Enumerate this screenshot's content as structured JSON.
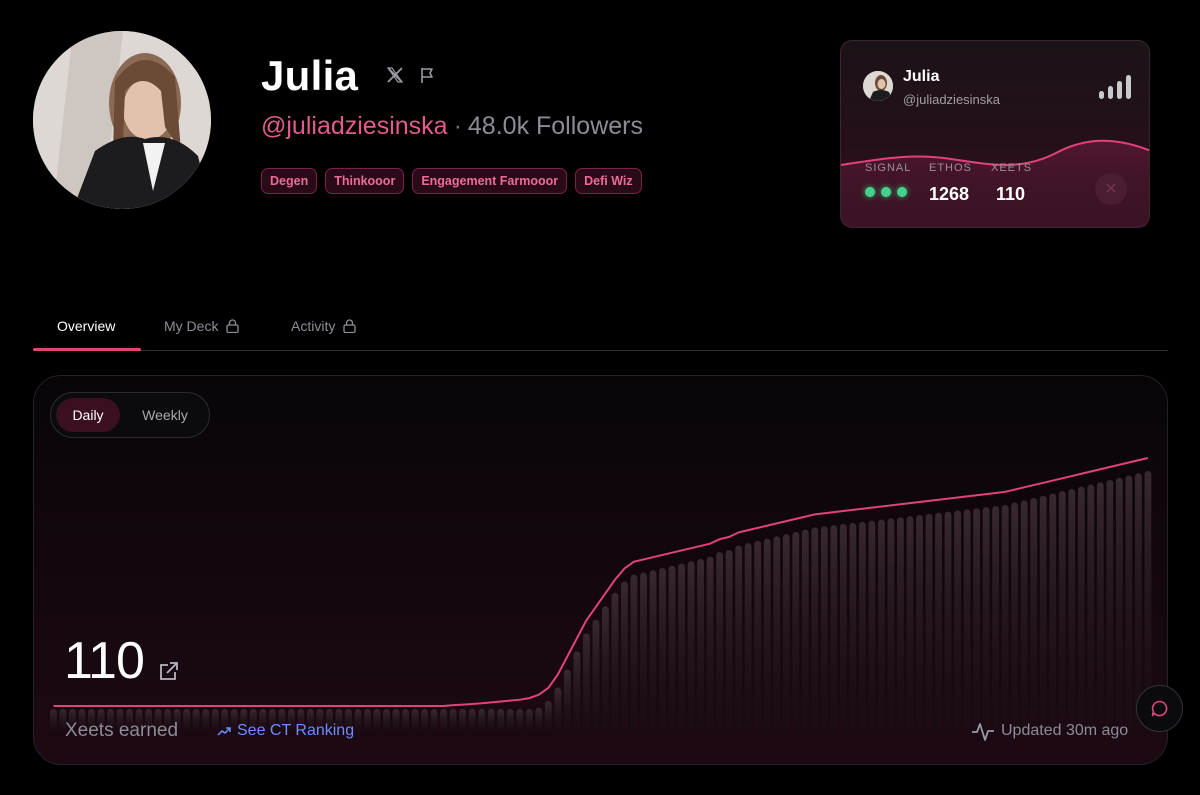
{
  "profile": {
    "name": "Julia",
    "handle": "@juliadziesinska",
    "separator": "·",
    "followers": "48.0k Followers",
    "tags": [
      "Degen",
      "Thinkooor",
      "Engagement Farmooor",
      "Defi Wiz"
    ]
  },
  "card": {
    "name": "Julia",
    "handle": "@juliadziesinska",
    "signal_label": "SIGNAL",
    "ethos_label": "ETHOS",
    "ethos_value": "1268",
    "xeets_label": "XEETS",
    "xeets_value": "110",
    "signal_dots_active": 3
  },
  "tabs": [
    {
      "label": "Overview",
      "active": true,
      "locked": false
    },
    {
      "label": "My Deck",
      "active": false,
      "locked": true
    },
    {
      "label": "Activity",
      "active": false,
      "locked": true
    }
  ],
  "chart_controls": {
    "daily_label": "Daily",
    "weekly_label": "Weekly",
    "selected": "Daily"
  },
  "summary": {
    "value": "110",
    "label": "Xeets earned",
    "ranking_link": "See CT Ranking",
    "updated": "Updated 30m ago"
  },
  "colors": {
    "accent": "#e0427a",
    "handle": "#e35b8e",
    "signal_green": "#43d28b",
    "link_blue": "#6f8cff"
  },
  "chart_data": {
    "type": "area",
    "series": [
      {
        "values": [
          0,
          0,
          0,
          0,
          0,
          0,
          0,
          0,
          0,
          0,
          0,
          0,
          0,
          0,
          0,
          0,
          0,
          0,
          0,
          0,
          0,
          0,
          0,
          0,
          0,
          0,
          0,
          0,
          0,
          0,
          0,
          0,
          0,
          0,
          0,
          0,
          0,
          0,
          0,
          0,
          0,
          0,
          0.4,
          0.6,
          0.9,
          1.2,
          1.6,
          2,
          2.4,
          2.8,
          3.5,
          5,
          8,
          14,
          22,
          30,
          38,
          44,
          50,
          56,
          61,
          64,
          65,
          66,
          67,
          68,
          69,
          70,
          71,
          72,
          74,
          75,
          77,
          78,
          79,
          80,
          81,
          82,
          83,
          84,
          85,
          85.5,
          86,
          86.5,
          87,
          87.5,
          88,
          88.5,
          89,
          89.5,
          90,
          90.5,
          91,
          91.5,
          92,
          92.5,
          93,
          93.5,
          94,
          94.5,
          95,
          96,
          97,
          98,
          99,
          100,
          101,
          102,
          103,
          104,
          105,
          106,
          107,
          108,
          109,
          110
        ]
      }
    ],
    "ylim": [
      0,
      110
    ],
    "grid": false,
    "legend": "none"
  }
}
